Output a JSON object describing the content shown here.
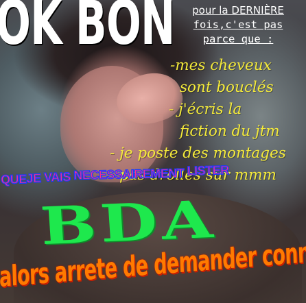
{
  "headline": "OK BON",
  "caption": {
    "line1": "pour la DERNIÈRE",
    "line2": "fois,c'est pas",
    "line3": "parce que :"
  },
  "reasons": [
    "-mes cheveux",
    "sont bouclés",
    "- j'écris la",
    "fiction du jtm",
    "- je poste des montages",
    "pas drolles sur mmm"
  ],
  "magenta_words": [
    "QUE",
    "JE",
    "VAIS",
    "NECESSAIREMENT",
    "LISTER"
  ],
  "big_letters": "BDA",
  "bottom_line": "alors arrete de demander connar",
  "colors": {
    "headline": "#ffffff",
    "reasons": "#f4ea3a",
    "magenta": "#ff2d8f",
    "magenta_outline": "#1a3cff",
    "bda": "#1ee84d",
    "bottom": "#ff7a00"
  }
}
